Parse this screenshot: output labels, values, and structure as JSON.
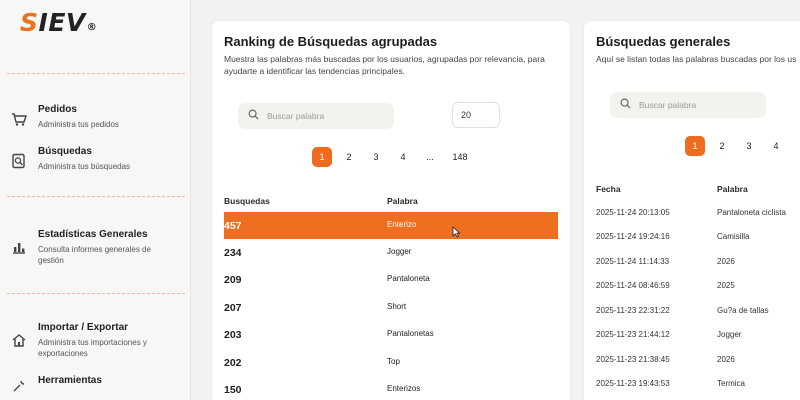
{
  "brand": {
    "logo_s": "S",
    "logo_rest": "IEV",
    "logo_reg": "®"
  },
  "sidebar": {
    "items": [
      {
        "title": "Pedidos",
        "subtitle": "Administra tus pedidos",
        "icon": "cart-icon"
      },
      {
        "title": "Búsquedas",
        "subtitle": "Administra tus búsquedas",
        "icon": "search-document-icon"
      },
      {
        "title": "Estadísticas Generales",
        "subtitle": "Consulta informes generales de gestión",
        "icon": "bar-chart-icon"
      },
      {
        "title": "Importar / Exportar",
        "subtitle": "Administra tus importaciones y exportaciones",
        "icon": "home-import-icon"
      },
      {
        "title": "Herramientas",
        "subtitle": "",
        "icon": "tools-icon"
      }
    ]
  },
  "ranking": {
    "title": "Ranking de Búsquedas agrupadas",
    "description": "Muestra las palabras más buscadas por los usuarios, agrupadas por relevancia, para ayudarte a identificar las tendencias principales.",
    "search_placeholder": "Buscar palabra",
    "page_size": "20",
    "pages": [
      "1",
      "2",
      "3",
      "4",
      "...",
      "148"
    ],
    "active_page": "1",
    "columns": [
      "Busquedas",
      "Palabra"
    ],
    "rows": [
      {
        "count": "457",
        "word": "Enterizo",
        "selected": true
      },
      {
        "count": "234",
        "word": "Jogger",
        "selected": false
      },
      {
        "count": "209",
        "word": "Pantaloneta",
        "selected": false
      },
      {
        "count": "207",
        "word": "Short",
        "selected": false
      },
      {
        "count": "203",
        "word": "Pantalonetas",
        "selected": false
      },
      {
        "count": "202",
        "word": "Top",
        "selected": false
      },
      {
        "count": "150",
        "word": "Enterizos",
        "selected": false
      }
    ]
  },
  "general": {
    "title": "Búsquedas generales",
    "description": "Aquí se listan todas las palabras buscadas por los us",
    "search_placeholder": "Buscar palabra",
    "pages": [
      "1",
      "2",
      "3",
      "4"
    ],
    "active_page": "1",
    "columns": [
      "Fecha",
      "Palabra"
    ],
    "rows": [
      {
        "date": "2025-11-24 20:13:05",
        "word": "Pantaloneta ciclista"
      },
      {
        "date": "2025-11-24 19:24:16",
        "word": "Camisilla"
      },
      {
        "date": "2025-11-24 11:14:33",
        "word": "2026"
      },
      {
        "date": "2025-11-24 08:46:59",
        "word": "2025"
      },
      {
        "date": "2025-11-23 22:31:22",
        "word": "Gu?a de tallas"
      },
      {
        "date": "2025-11-23 21:44:12",
        "word": "Jogger"
      },
      {
        "date": "2025-11-23 21:38:45",
        "word": "2026"
      },
      {
        "date": "2025-11-23 19:43:53",
        "word": "Termica"
      }
    ]
  },
  "colors": {
    "accent": "#ee6b1f",
    "sidebar_bg": "#f7f7f5",
    "divider": "#f0b7a6"
  }
}
